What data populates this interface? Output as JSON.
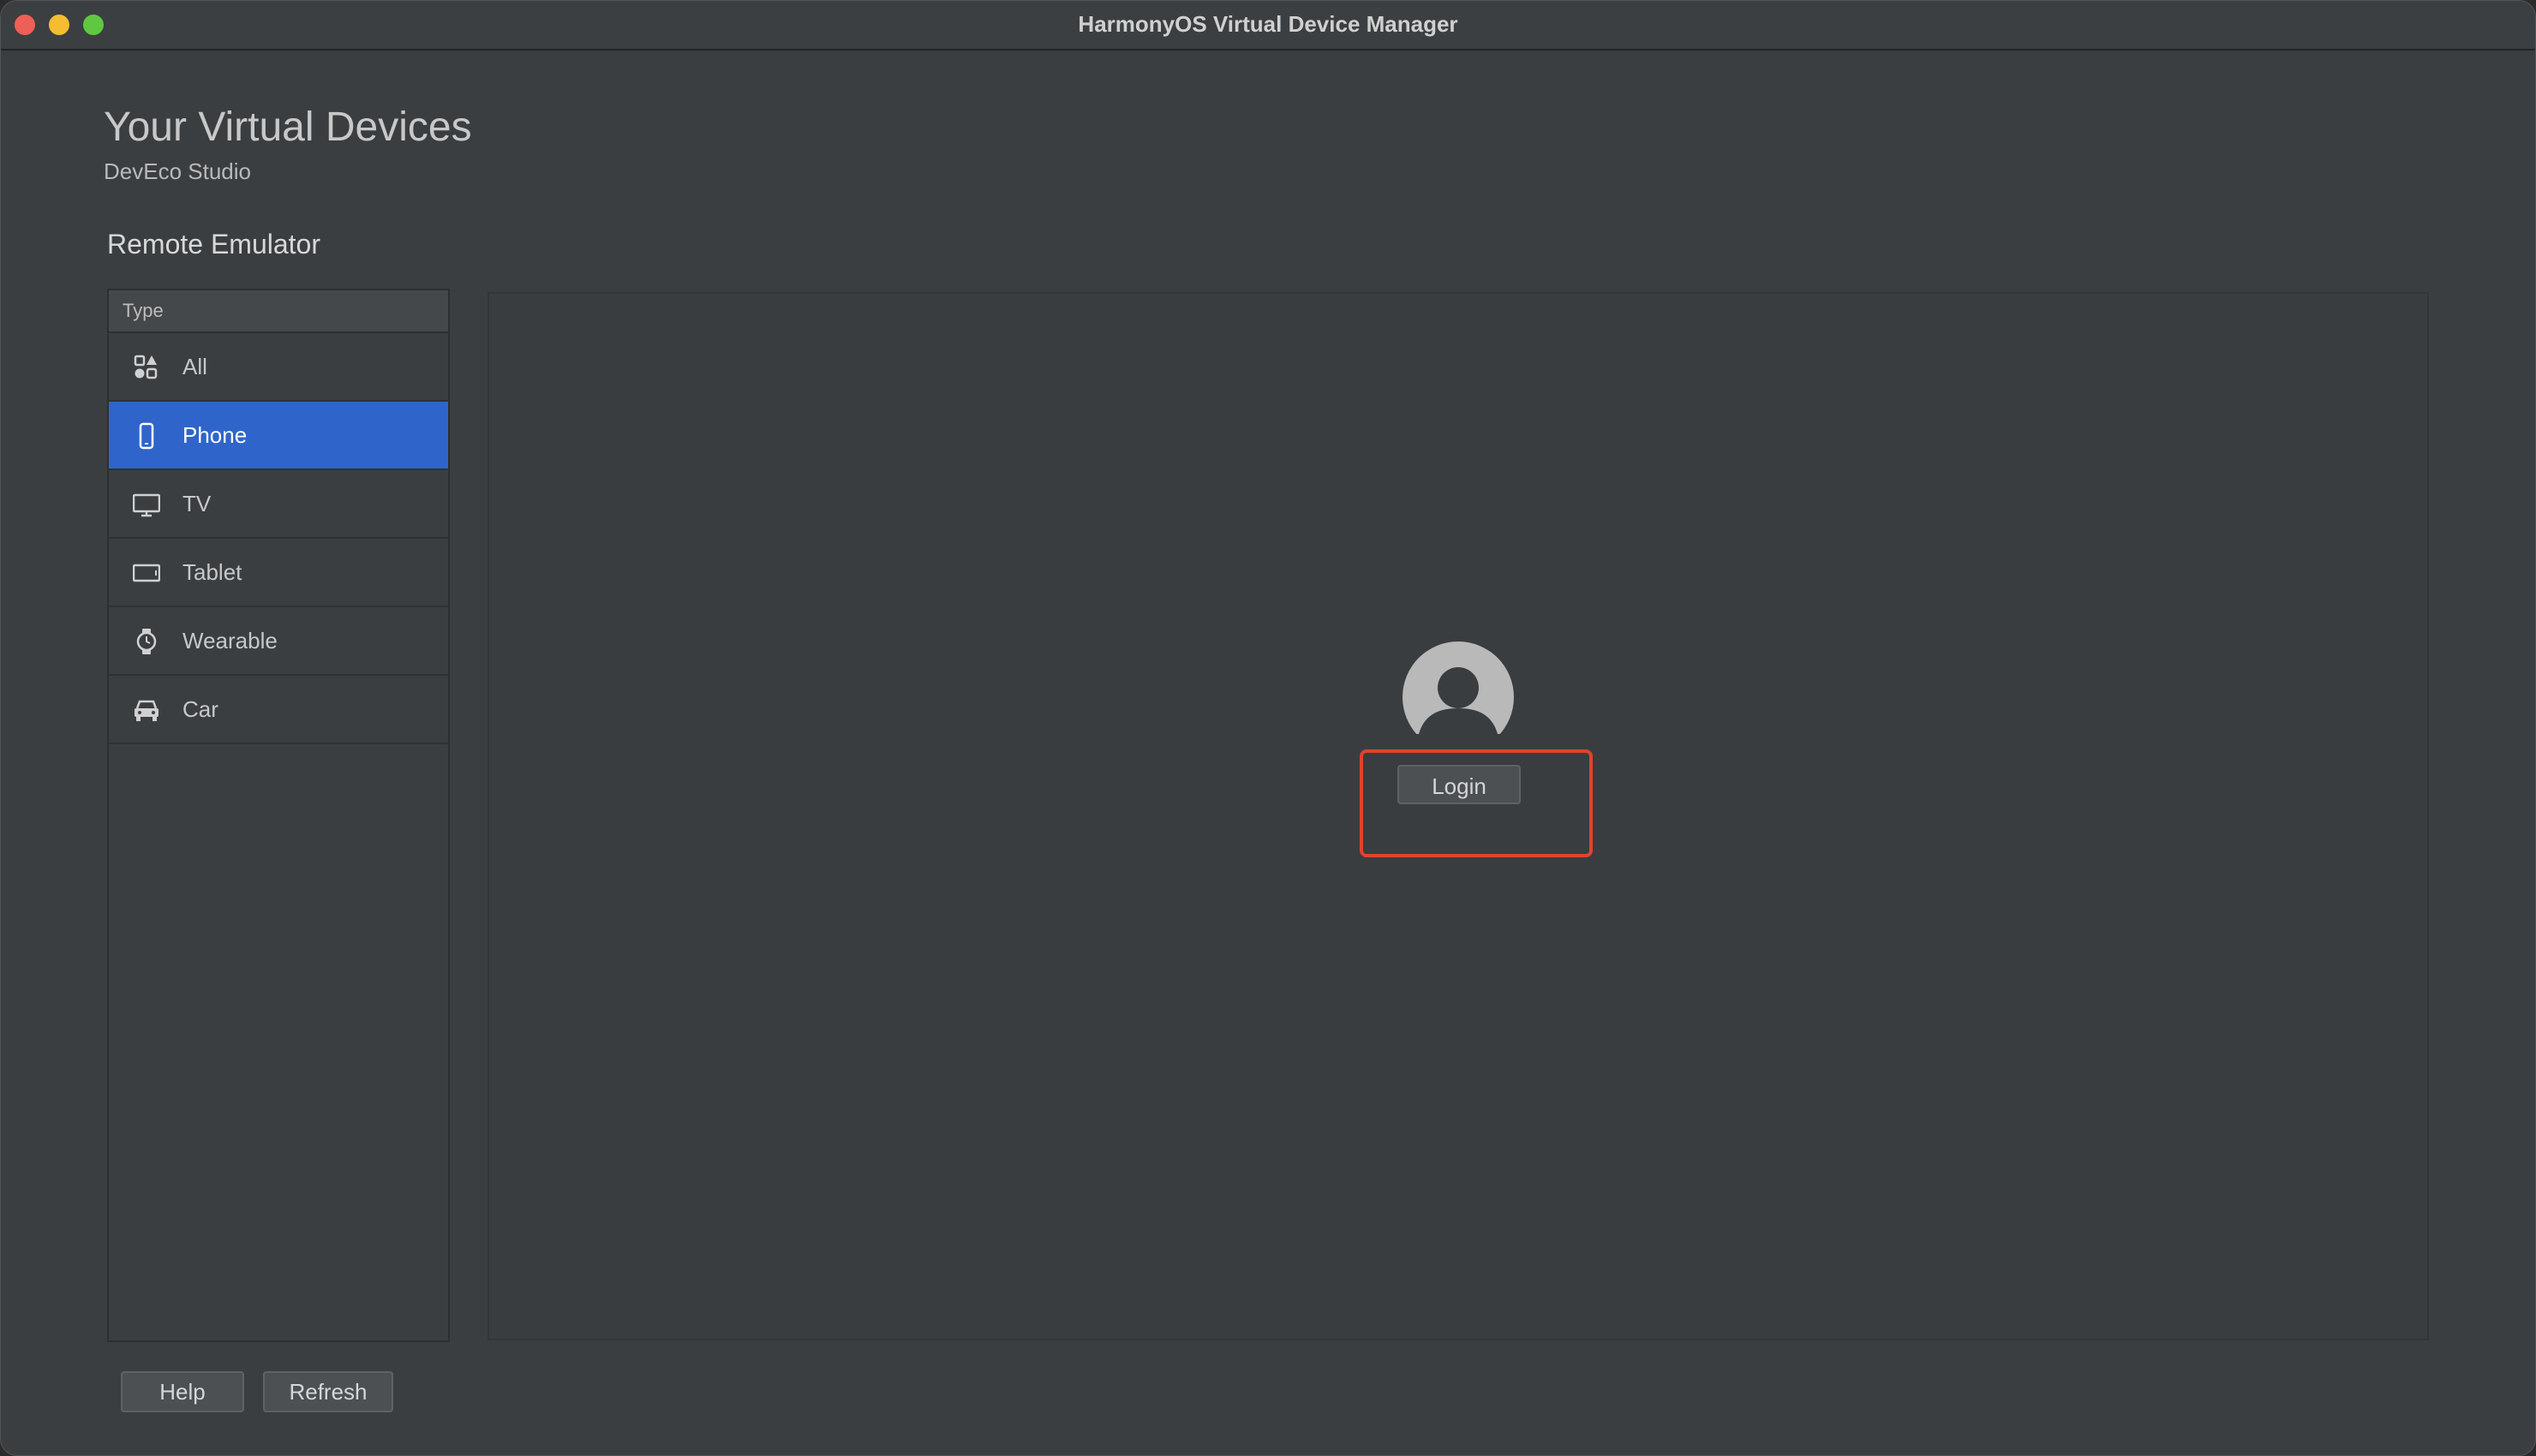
{
  "window": {
    "title": "HarmonyOS Virtual Device Manager"
  },
  "header": {
    "title": "Your Virtual Devices",
    "subtitle": "DevEco Studio"
  },
  "section": {
    "title": "Remote Emulator"
  },
  "type_panel": {
    "header": "Type",
    "items": [
      {
        "label": "All",
        "icon": "grid-icon",
        "selected": false
      },
      {
        "label": "Phone",
        "icon": "phone-icon",
        "selected": true
      },
      {
        "label": "TV",
        "icon": "tv-icon",
        "selected": false
      },
      {
        "label": "Tablet",
        "icon": "tablet-icon",
        "selected": false
      },
      {
        "label": "Wearable",
        "icon": "watch-icon",
        "selected": false
      },
      {
        "label": "Car",
        "icon": "car-icon",
        "selected": false
      }
    ]
  },
  "content": {
    "avatar_icon": "user-avatar-icon",
    "login_label": "Login"
  },
  "footer": {
    "help_label": "Help",
    "refresh_label": "Refresh"
  },
  "colors": {
    "selected": "#2f65ca",
    "highlight": "#e0432d",
    "background": "#3b3e41"
  }
}
